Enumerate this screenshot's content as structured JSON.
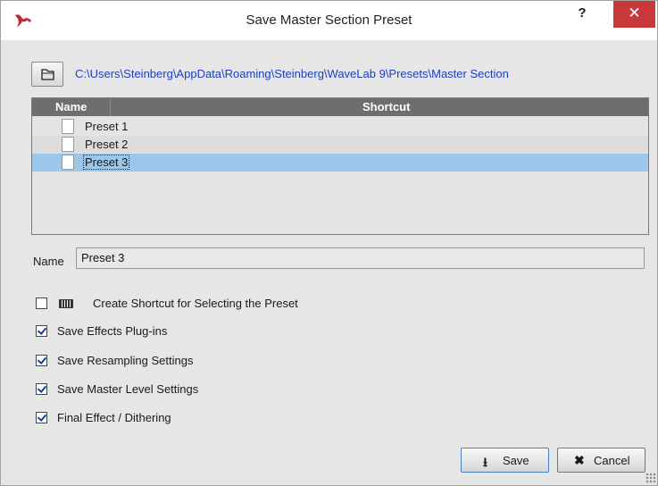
{
  "window": {
    "title": "Save Master Section Preset",
    "help_symbol": "?",
    "close_symbol": "✕"
  },
  "path": {
    "folder_button_icon": "folder-icon",
    "text": "C:\\Users\\Steinberg\\AppData\\Roaming\\Steinberg\\WaveLab 9\\Presets\\Master Section"
  },
  "list": {
    "columns": [
      "Name",
      "Shortcut"
    ],
    "rows": [
      {
        "name": "Preset 1",
        "shortcut": ""
      },
      {
        "name": "Preset 2",
        "shortcut": ""
      },
      {
        "name": "Preset 3",
        "shortcut": "",
        "selected": true
      }
    ]
  },
  "name_field": {
    "label": "Name",
    "value": "Preset 3"
  },
  "options": [
    {
      "label": "Create Shortcut for Selecting the Preset",
      "checked": false,
      "icon": "keyboard-icon"
    },
    {
      "label": "Save Effects Plug-ins",
      "checked": true
    },
    {
      "label": "Save Resampling Settings",
      "checked": true
    },
    {
      "label": "Save Master Level Settings",
      "checked": true
    },
    {
      "label": "Final Effect / Dithering",
      "checked": true
    }
  ],
  "buttons": {
    "save_label": "Save",
    "save_icon": "⭳",
    "cancel_label": "Cancel",
    "cancel_icon": "✖"
  },
  "colors": {
    "path_link": "#1b3fc2",
    "selection": "#9cc6ea",
    "close_button": "#c7393b",
    "header": "#6e6e6e"
  }
}
